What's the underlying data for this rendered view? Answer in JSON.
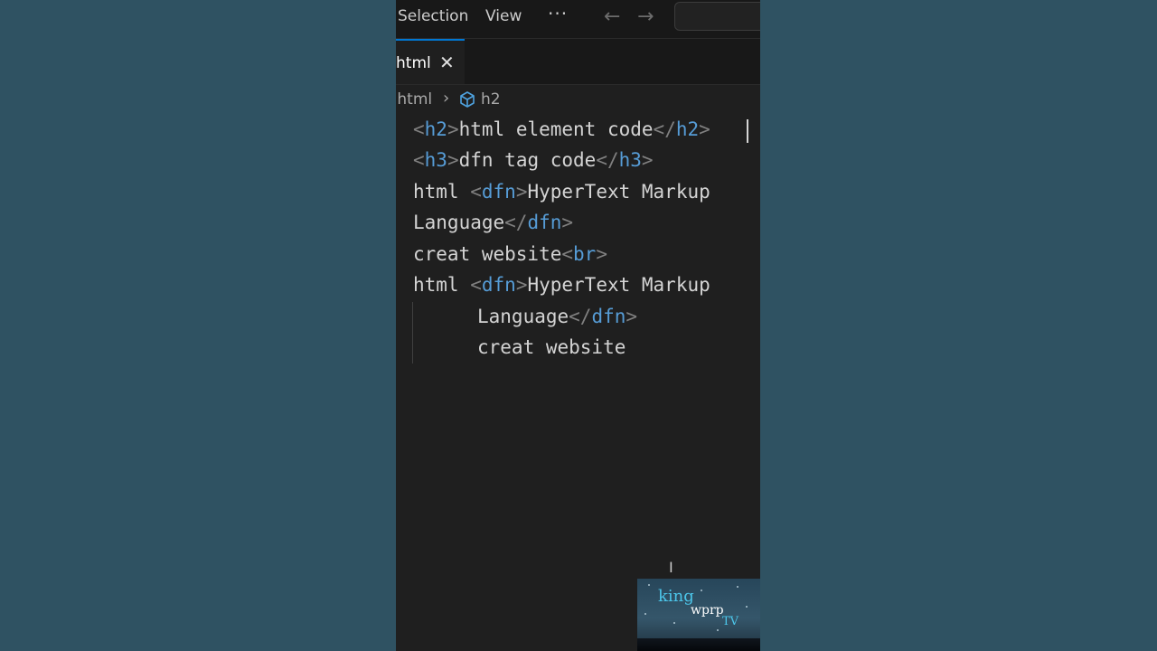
{
  "titlebar": {
    "menu": [
      "Selection",
      "View"
    ],
    "more_icon": "ellipsis-icon",
    "back_icon": "arrow-left-icon",
    "forward_icon": "arrow-right-icon"
  },
  "tab": {
    "label": "html",
    "close_glyph": "✕"
  },
  "breadcrumb": {
    "file": ".html",
    "separator": "›",
    "element": "h2",
    "element_icon": "cube-icon"
  },
  "code": {
    "line1": {
      "open": "h2",
      "text": "html element code",
      "close": "h2"
    },
    "line2": {
      "open": "h3",
      "text": "dfn tag code",
      "close": "h3"
    },
    "line3": {
      "prefix": "html ",
      "open": "dfn",
      "text": "HyperText Markup"
    },
    "line4": {
      "text": "Language",
      "close": "dfn"
    },
    "line5": {
      "text": "creat website",
      "open": "br"
    },
    "line6": {
      "prefix": "html ",
      "open": "dfn",
      "text": "HyperText Markup"
    },
    "line7": {
      "text": "Language",
      "close": "dfn"
    },
    "line8": {
      "text": "creat website"
    }
  },
  "watermark": {
    "word1": "king",
    "word2": "wprp",
    "word3": "TV"
  },
  "colors": {
    "background": "#2f5161",
    "editor": "#1f1f1f",
    "tag": "#569cd6",
    "accent": "#0078d4"
  }
}
